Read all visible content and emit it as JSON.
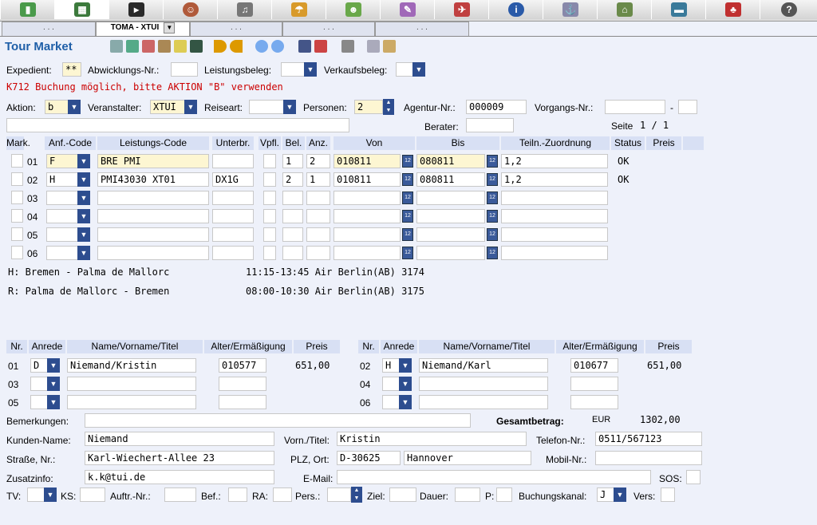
{
  "toolbar": {
    "icons": [
      "book-icon",
      "calculator-icon",
      "terminal-icon",
      "person-icon",
      "bell-icon",
      "beach-umbrella-icon",
      "family-icon",
      "document-icon",
      "shoe-icon",
      "info-icon",
      "ship-icon",
      "hotel-icon",
      "car-icon",
      "bellboy-icon",
      "help-icon"
    ]
  },
  "tabs": [
    {
      "label": ". . ."
    },
    {
      "label": "TOMA - XTUI"
    },
    {
      "label": ". . ."
    },
    {
      "label": ". . ."
    },
    {
      "label": ". . ."
    }
  ],
  "title": "Tour Market",
  "header": {
    "expedient_label": "Expedient:",
    "expedient_value": "**",
    "abwicklung_label": "Abwicklungs-Nr.:",
    "leistungsbeleg_label": "Leistungsbeleg:",
    "verkaufsbeleg_label": "Verkaufsbeleg:"
  },
  "message": "K712 Buchung möglich, bitte AKTION \"B\" verwenden",
  "form": {
    "aktion_label": "Aktion:",
    "aktion_value": "b",
    "veranstalter_label": "Veranstalter:",
    "veranstalter_value": "XTUI",
    "reiseart_label": "Reiseart:",
    "personen_label": "Personen:",
    "personen_value": "2",
    "agentur_label": "Agentur-Nr.:",
    "agentur_value": "000009",
    "vorgang_label": "Vorgangs-Nr.:",
    "vorgang_sep": "-",
    "berater_label": "Berater:",
    "seite_label": "Seite",
    "seite_value": "1 / 1"
  },
  "services": {
    "columns": [
      "Mark.",
      "Anf.-Code",
      "Leistungs-Code",
      "Unterbr.",
      "Vpfl.",
      "Bel.",
      "Anz.",
      "Von",
      "Bis",
      "Teiln.-Zuordnung",
      "Status",
      "Preis"
    ],
    "rows": [
      {
        "nr": "01",
        "code": "F",
        "leistung": "BRE PMI",
        "unterbr": "",
        "bel": "1",
        "anz": "2",
        "von": "010811",
        "bis": "080811",
        "teiln": "1,2",
        "status": "OK"
      },
      {
        "nr": "02",
        "code": "H",
        "leistung": "PMI43030 XT01",
        "unterbr": "DX1G",
        "bel": "2",
        "anz": "1",
        "von": "010811",
        "bis": "080811",
        "teiln": "1,2",
        "status": "OK"
      },
      {
        "nr": "03"
      },
      {
        "nr": "04"
      },
      {
        "nr": "05"
      },
      {
        "nr": "06"
      }
    ]
  },
  "flights": [
    {
      "route": "H: Bremen - Palma de Mallorc",
      "info": "11:15-13:45 Air Berlin(AB) 3174"
    },
    {
      "route": "R: Palma de Mallorc - Bremen",
      "info": "08:00-10:30 Air Berlin(AB) 3175"
    }
  ],
  "travellers": {
    "columns": [
      "Nr.",
      "Anrede",
      "Name/Vorname/Titel",
      "Alter/Ermäßigung",
      "Preis"
    ],
    "left": [
      {
        "nr": "01",
        "anrede": "D",
        "name": "Niemand/Kristin",
        "alter": "010577",
        "preis": "651,00"
      },
      {
        "nr": "03"
      },
      {
        "nr": "05"
      }
    ],
    "right": [
      {
        "nr": "02",
        "anrede": "H",
        "name": "Niemand/Karl",
        "alter": "010677",
        "preis": "651,00"
      },
      {
        "nr": "04"
      },
      {
        "nr": "06"
      }
    ]
  },
  "footer": {
    "bemerkungen_label": "Bemerkungen:",
    "gesamt_label": "Gesamtbetrag:",
    "currency": "EUR",
    "gesamt_value": "1302,00",
    "kunden_label": "Kunden-Name:",
    "kunden_value": "Niemand",
    "vorn_label": "Vorn./Titel:",
    "vorn_value": "Kristin",
    "telefon_label": "Telefon-Nr.:",
    "telefon_value": "0511/567123",
    "strasse_label": "Straße, Nr.:",
    "strasse_value": "Karl-Wiechert-Allee 23",
    "plz_label": "PLZ, Ort:",
    "plz_value": "D-30625",
    "ort_value": "Hannover",
    "mobil_label": "Mobil-Nr.:",
    "zusatz_label": "Zusatzinfo:",
    "zusatz_value": "k.k@tui.de",
    "email_label": "E-Mail:",
    "sos_label": "SOS:",
    "tv_label": "TV:",
    "ks_label": "KS:",
    "auftr_label": "Auftr.-Nr.:",
    "bef_label": "Bef.:",
    "ra_label": "RA:",
    "pers_label": "Pers.:",
    "ziel_label": "Ziel:",
    "dauer_label": "Dauer:",
    "p_label": "P:",
    "kanal_label": "Buchungskanal:",
    "kanal_value": "J",
    "vers_label": "Vers:"
  },
  "colors": {
    "accent": "#2d4d8f",
    "title": "#1f5fa8",
    "message": "#cc0000",
    "header_bg": "#d8e0f4",
    "highlight": "#fdf6d2"
  }
}
